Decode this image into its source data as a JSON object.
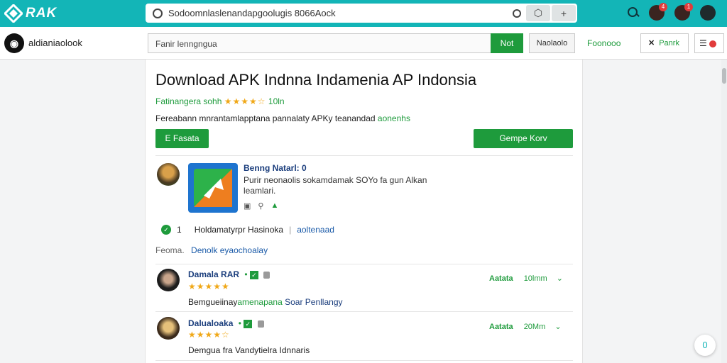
{
  "browser": {
    "logo_text": "RAK",
    "url": "Sodoomnlaslenandapgoolugis 8066Aock",
    "notification_count_1": "4",
    "notification_count_2": "1"
  },
  "nav": {
    "site_name": "aldianiaolook",
    "search_value": "Fanir lenngngua",
    "next_label": "Not",
    "secondary_label": "Naolaolo",
    "link_label": "Foonooo",
    "outline_label": "Panrk",
    "menu_label": "E"
  },
  "main": {
    "title": "Download APK Indnna Indamenia AP Indonsia",
    "rating_prefix": "Fatinangera sohh",
    "rating_stars": "★★★★☆",
    "rating_count": "10ln",
    "desc_prefix": "Fereabann mnrantamlapptana pannalaty APKy teanandad",
    "desc_highlight": "aonenhs",
    "btn_left": "E Fasata",
    "btn_right": "Gempe Korv"
  },
  "app": {
    "name": "Benng Natarl: 0",
    "description": "Purir neonaolis sokamdamak SOYo fa gun Alkan leamlari."
  },
  "info": {
    "count": "1",
    "text": "Holdamatyrpr Hasinoka",
    "link": "aoltenaad"
  },
  "section": {
    "label": "Feoma.",
    "link": "Denolk eyaochoalay"
  },
  "reviews": [
    {
      "name": "Damala RAR",
      "stars": "★★★★★",
      "text_prefix": "Bemgueiinay",
      "text_highlight": "amenapana",
      "text_suffix": "Soar Penllangy",
      "side_label": "Aatata",
      "side_value": "10lmm",
      "side_chev": "⌄"
    },
    {
      "name": "Dalualoaka",
      "stars": "★★★★☆",
      "text_prefix": "Demgua fra Vandytielra Idnnaris",
      "text_highlight": "",
      "text_suffix": "",
      "side_label": "Aatata",
      "side_value": "20Mm",
      "side_chev": "⌄"
    }
  ],
  "chat_label": "0",
  "colors": {
    "accent": "#13b5b7",
    "primary_green": "#1e9b3c",
    "star": "#f0a818",
    "link_blue": "#1a5aa8"
  }
}
